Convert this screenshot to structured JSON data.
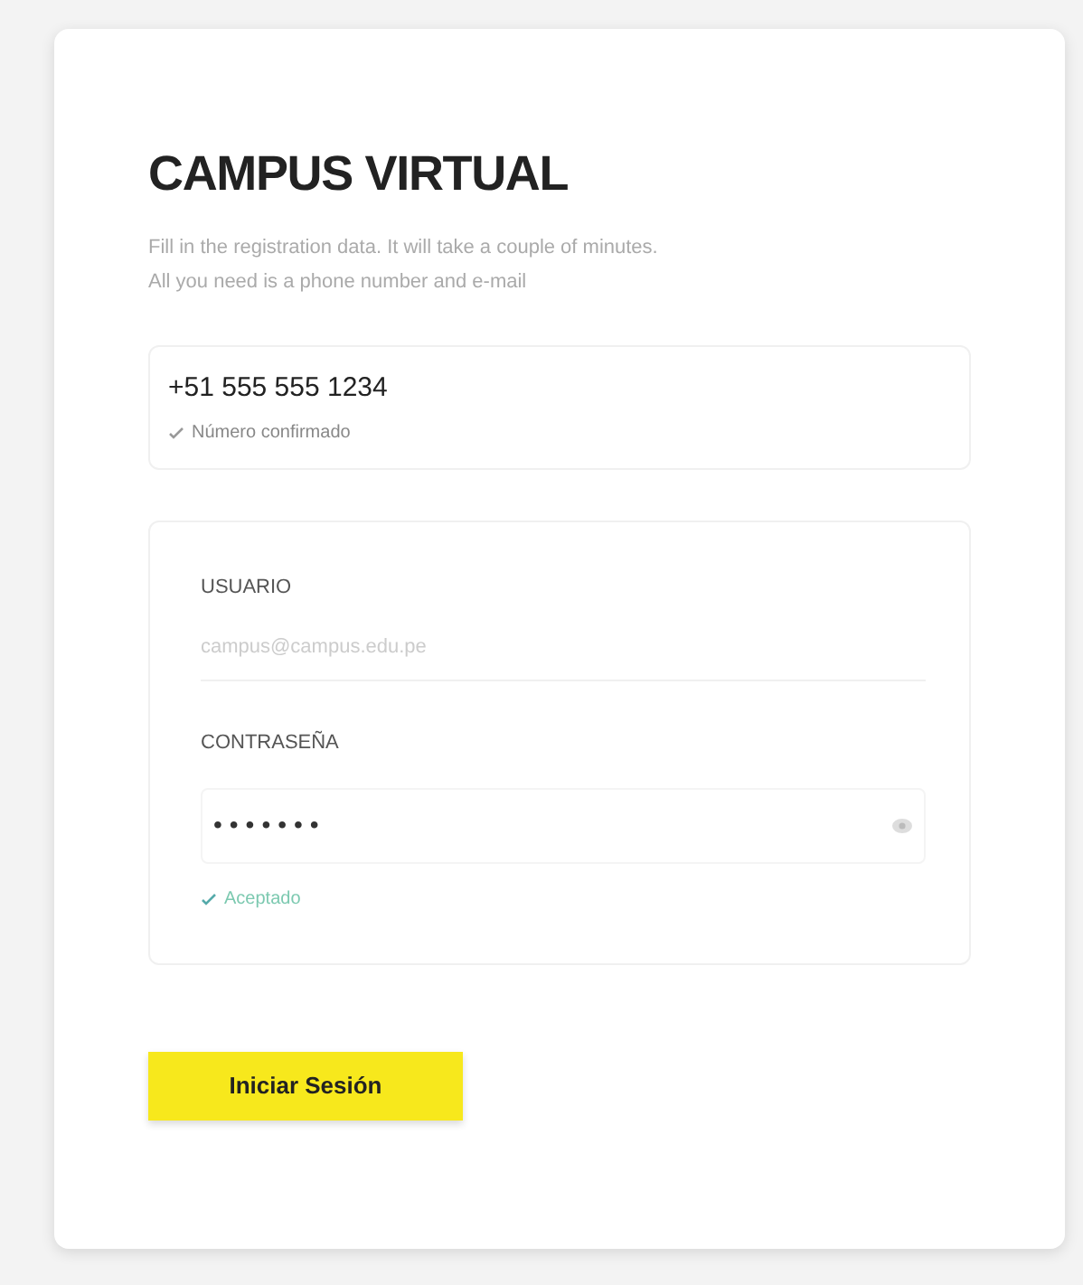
{
  "title": "CAMPUS VIRTUAL",
  "subtitle": [
    "Fill in the registration data. It will take a couple of minutes.",
    "All you need is a phone number and e-mail"
  ],
  "phone": {
    "value": "+51 555 555 1234",
    "status": "Número confirmado",
    "confirmed": true
  },
  "fields": [
    {
      "kind": "text",
      "label": "USUARIO",
      "placeholder": "campus@campus.edu.pe"
    },
    {
      "kind": "password",
      "label": "CONTRASEÑA",
      "value": "•••••••",
      "status": "Aceptado",
      "valid": true
    }
  ],
  "button": "Iniciar Sesión"
}
